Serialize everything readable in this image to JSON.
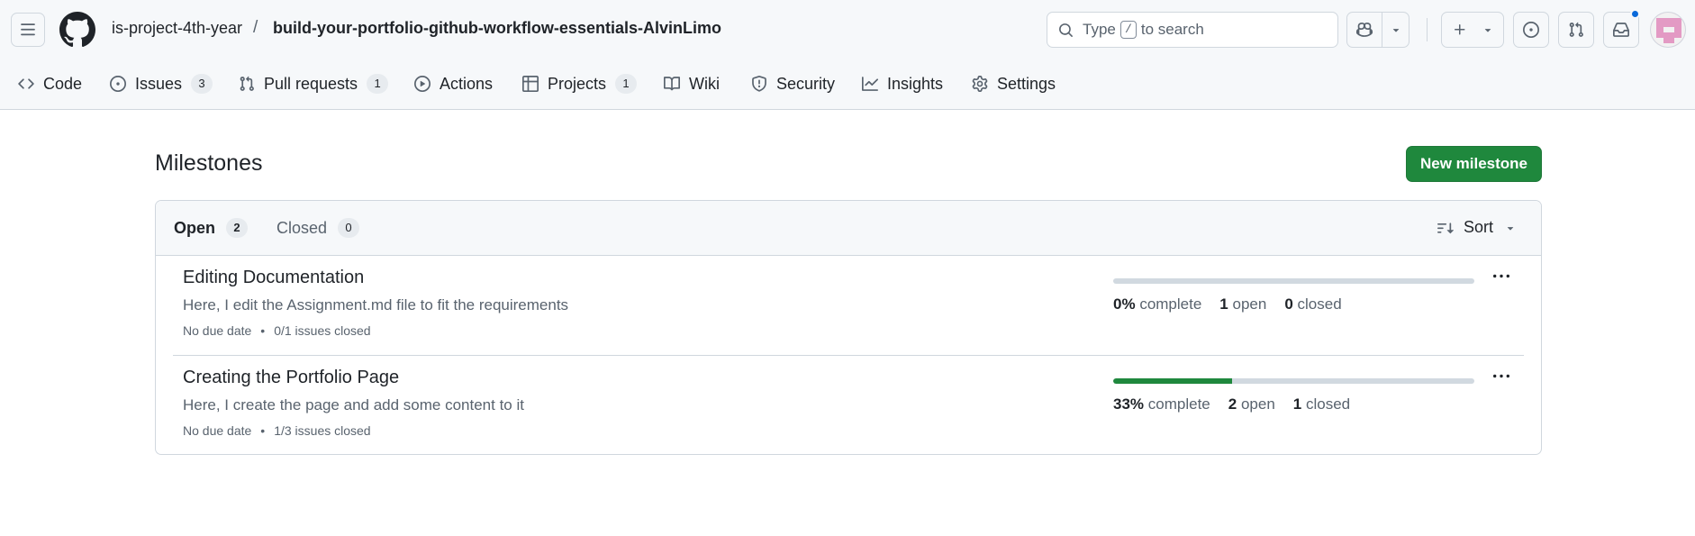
{
  "header": {
    "owner": "is-project-4th-year",
    "separator": "/",
    "repo": "build-your-portfolio-github-workflow-essentials-AlvinLimo",
    "search": {
      "prefix": "Type",
      "key": "/",
      "suffix": "to search"
    }
  },
  "nav": [
    {
      "label": "Code",
      "icon": "code-icon"
    },
    {
      "label": "Issues",
      "icon": "issue-opened-icon",
      "count": "3"
    },
    {
      "label": "Pull requests",
      "icon": "git-pull-request-icon",
      "count": "1"
    },
    {
      "label": "Actions",
      "icon": "play-icon"
    },
    {
      "label": "Projects",
      "icon": "table-icon",
      "count": "1"
    },
    {
      "label": "Wiki",
      "icon": "book-icon"
    },
    {
      "label": "Security",
      "icon": "shield-icon"
    },
    {
      "label": "Insights",
      "icon": "graph-icon"
    },
    {
      "label": "Settings",
      "icon": "gear-icon"
    }
  ],
  "page": {
    "title": "Milestones",
    "new_button": "New milestone"
  },
  "filters": {
    "open_label": "Open",
    "open_count": "2",
    "closed_label": "Closed",
    "closed_count": "0",
    "sort_label": "Sort"
  },
  "milestones": [
    {
      "title": "Editing Documentation",
      "description": "Here, I edit the Assignment.md file to fit the requirements",
      "due": "No due date",
      "issues": "0/1 issues closed",
      "percent": "0%",
      "percent_value": 0,
      "complete_label": "complete",
      "open_count": "1",
      "open_label": "open",
      "closed_count": "0",
      "closed_label": "closed"
    },
    {
      "title": "Creating the Portfolio Page",
      "description": "Here, I create the page and add some content to it",
      "due": "No due date",
      "issues": "1/3 issues closed",
      "percent": "33%",
      "percent_value": 33,
      "complete_label": "complete",
      "open_count": "2",
      "open_label": "open",
      "closed_count": "1",
      "closed_label": "closed"
    }
  ],
  "colors": {
    "accent_green": "#1f883d",
    "link_blue": "#0969da",
    "muted": "#59636e"
  }
}
